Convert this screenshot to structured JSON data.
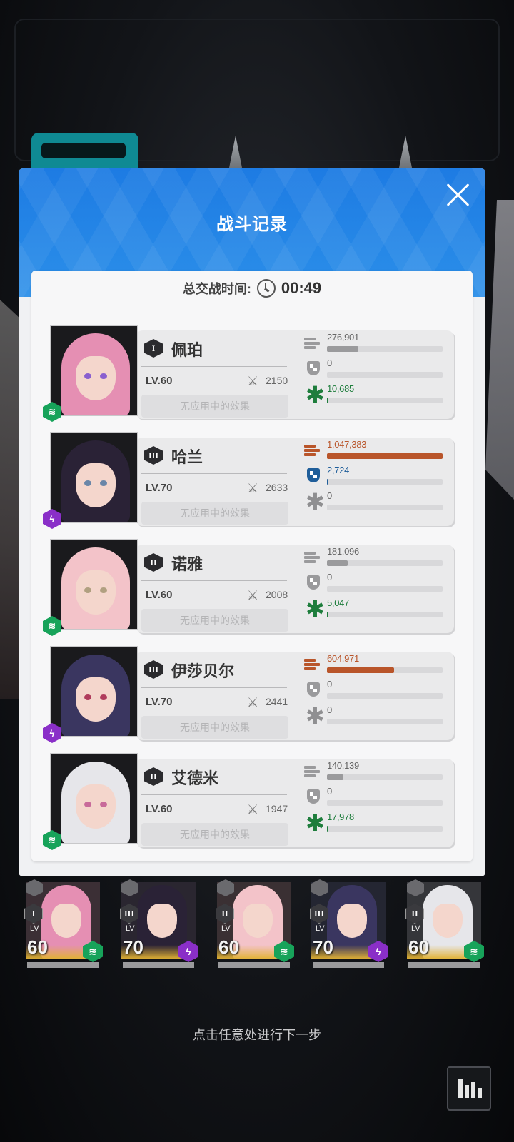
{
  "modal": {
    "title": "战斗记录",
    "total_time_label": "总交战时间:",
    "total_time": "00:49"
  },
  "colors": {
    "header_blue": "#1d7be3",
    "damage_orange": "#b9552a",
    "shield_blue": "#1f5e9a",
    "heal_green": "#1e7d3c",
    "wind_green": "#17a35a",
    "electric_purple": "#8a2fc8"
  },
  "characters": [
    {
      "name": "佩珀",
      "burst": "I",
      "level": "LV.60",
      "power": "2150",
      "effect": "无应用中的效果",
      "element": "wind-icon",
      "damage": "276,901",
      "damage_frac": 0.27,
      "shield": "0",
      "shield_frac": 0,
      "heal": "10,685",
      "heal_frac": 0.01
    },
    {
      "name": "哈兰",
      "burst": "III",
      "level": "LV.70",
      "power": "2633",
      "effect": "无应用中的效果",
      "element": "electric-icon",
      "damage": "1,047,383",
      "damage_frac": 1.0,
      "shield": "2,724",
      "shield_frac": 0.01,
      "heal": "0",
      "heal_frac": 0
    },
    {
      "name": "诺雅",
      "burst": "II",
      "level": "LV.60",
      "power": "2008",
      "effect": "无应用中的效果",
      "element": "wind-icon",
      "damage": "181,096",
      "damage_frac": 0.18,
      "shield": "0",
      "shield_frac": 0,
      "heal": "5,047",
      "heal_frac": 0.005
    },
    {
      "name": "伊莎贝尔",
      "burst": "III",
      "level": "LV.70",
      "power": "2441",
      "effect": "无应用中的效果",
      "element": "electric-icon",
      "damage": "604,971",
      "damage_frac": 0.58,
      "shield": "0",
      "shield_frac": 0,
      "heal": "0",
      "heal_frac": 0
    },
    {
      "name": "艾德米",
      "burst": "II",
      "level": "LV.60",
      "power": "1947",
      "effect": "无应用中的效果",
      "element": "wind-icon",
      "damage": "140,139",
      "damage_frac": 0.14,
      "shield": "0",
      "shield_frac": 0,
      "heal": "17,978",
      "heal_frac": 0.012
    }
  ],
  "roster": [
    {
      "burst": "I",
      "lv_label": "LV",
      "level": "60",
      "element": "wind-icon"
    },
    {
      "burst": "III",
      "lv_label": "LV",
      "level": "70",
      "element": "electric-icon"
    },
    {
      "burst": "II",
      "lv_label": "LV",
      "level": "60",
      "element": "wind-icon"
    },
    {
      "burst": "III",
      "lv_label": "LV",
      "level": "70",
      "element": "electric-icon"
    },
    {
      "burst": "II",
      "lv_label": "LV",
      "level": "60",
      "element": "wind-icon"
    }
  ],
  "hint": "点击任意处进行下一步"
}
